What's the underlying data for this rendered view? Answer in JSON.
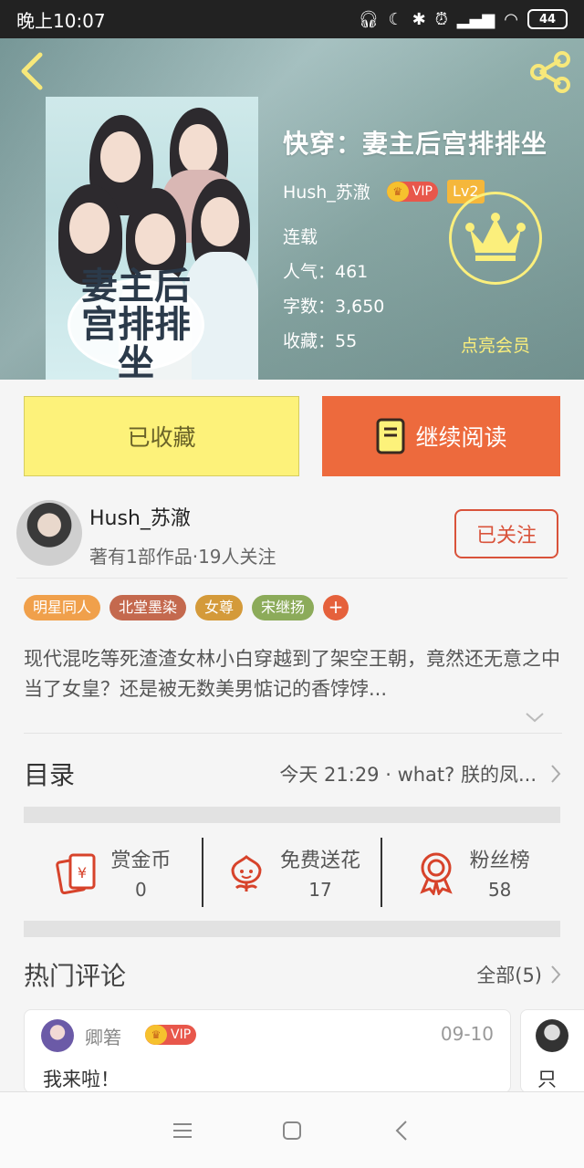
{
  "status_bar": {
    "time": "晚上10:07",
    "battery": "44"
  },
  "book": {
    "title": "快穿：妻主后宫排排坐",
    "cover_text": "妻主后宫排排坐",
    "author": "Hush_苏澈",
    "vip_label": "VIP",
    "level": "Lv2",
    "status": "连载",
    "popularity": "人气：461",
    "word_count": "字数：3,650",
    "favorites": "收藏：55",
    "light_vip": "点亮会员"
  },
  "actions": {
    "collected": "已收藏",
    "continue_reading": "继续阅读"
  },
  "author_card": {
    "name": "Hush_苏澈",
    "stats": "著有1部作品·19人关注",
    "follow": "已关注"
  },
  "tags": [
    {
      "label": "明星同人",
      "color": "#f0a04b"
    },
    {
      "label": "北堂墨染",
      "color": "#c4694e"
    },
    {
      "label": "女尊",
      "color": "#d49a3a"
    },
    {
      "label": "宋继扬",
      "color": "#8cab5a"
    }
  ],
  "tag_add": "+",
  "description": "现代混吃等死渣渣女林小白穿越到了架空王朝，竟然还无意之中当了女皇？还是被无数美男惦记的香饽饽...",
  "catalog": {
    "label": "目录",
    "latest": "今天 21:29 · what? 朕的凤..."
  },
  "stats": [
    {
      "label": "赏金币",
      "value": "0",
      "color": "#d7432b"
    },
    {
      "label": "免费送花",
      "value": "17",
      "color": "#d7432b"
    },
    {
      "label": "粉丝榜",
      "value": "58",
      "color": "#d7432b"
    }
  ],
  "hot_comments": {
    "title": "热门评论",
    "all": "全部(5)",
    "items": [
      {
        "user": "卿箬",
        "vip": "VIP",
        "date": "09-10",
        "text": "我来啦！"
      },
      {
        "text": "只"
      }
    ]
  }
}
